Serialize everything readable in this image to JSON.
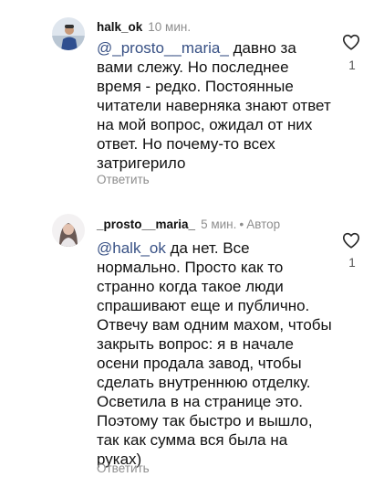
{
  "comments": [
    {
      "username": "halk_ok",
      "time": "10 мин.",
      "author_tag": "",
      "mention": "@_prosto__maria_",
      "text": " давно за вами слежу. Но последнее время - редко. Постоянные читатели наверняка знают ответ на мой вопрос, ожидал от них ответ. Но почему-то всех затригерило",
      "reply_label": "Ответить",
      "likes": "1",
      "like_icon": "heart-outline-icon"
    },
    {
      "username": "_prosto__maria_",
      "time": "5 мин.",
      "separator": "•",
      "author_tag": "Автор",
      "mention": "@halk_ok",
      "text": " да нет. Все нормально. Просто как то странно когда такое люди спрашивают еще и публично. Отвечу вам одним махом, чтобы закрыть вопрос: я в начале осени продала завод, чтобы сделать внутреннюю отделку. Осветила в на странице это. Поэтому так быстро и вышло, так как сумма вся была на руках)",
      "reply_label": "Ответить",
      "likes": "1",
      "like_icon": "heart-outline-icon"
    }
  ],
  "colors": {
    "mention": "#385185",
    "meta": "#8e8e8e",
    "text": "#111111"
  }
}
